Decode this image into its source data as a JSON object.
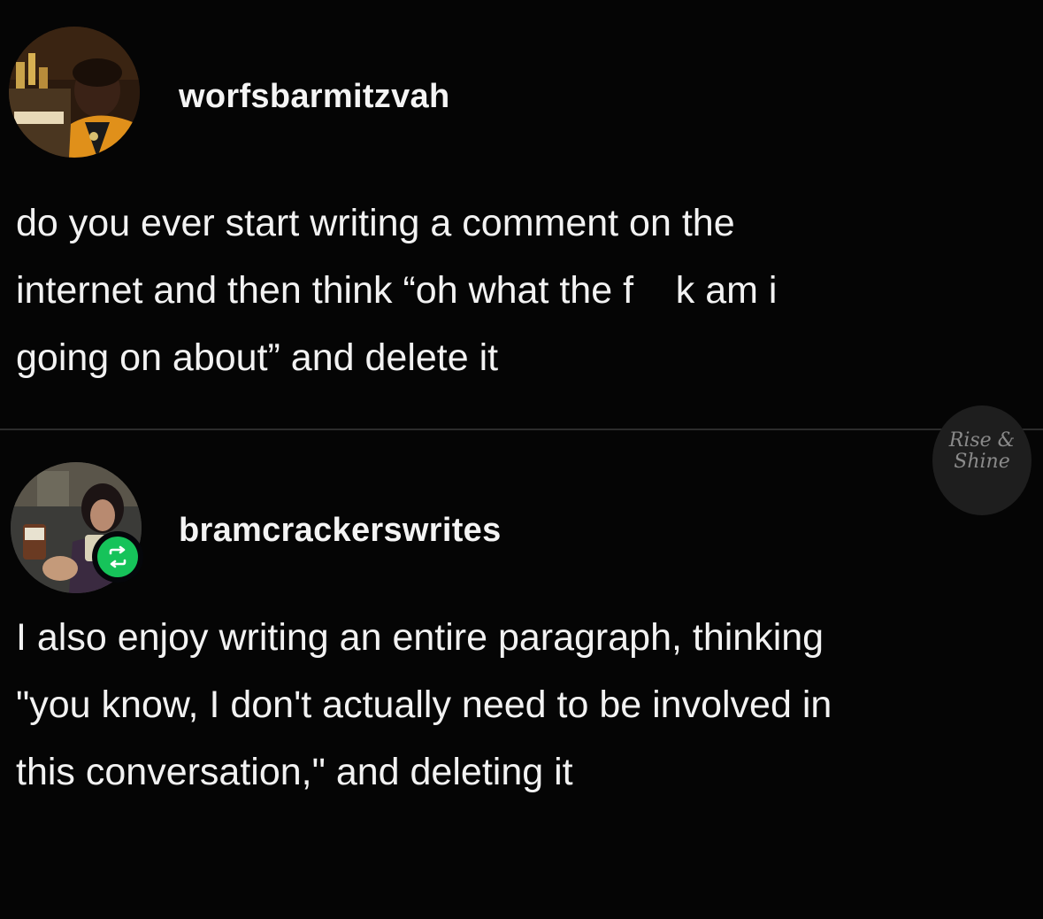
{
  "posts": [
    {
      "username": "worfsbarmitzvah",
      "avatar_icon": "user-avatar-photo",
      "lines": [
        "do you ever start writing a comment on the",
        "internet and then think “oh what the f    k am i",
        "going on about” and delete it"
      ]
    },
    {
      "username": "bramcrackerswrites",
      "avatar_icon": "user-avatar-photo",
      "badge_icon": "reblog-icon",
      "lines": [
        "I also enjoy writing an entire paragraph, thinking",
        "\"you know, I don't actually need to be involved in",
        "this conversation,\" and deleting it"
      ]
    }
  ],
  "watermark": {
    "line1": "Rise &",
    "line2": "Shine"
  },
  "colors": {
    "background": "#050505",
    "text": "#f2f2f2",
    "reblog_green": "#16c35a"
  }
}
